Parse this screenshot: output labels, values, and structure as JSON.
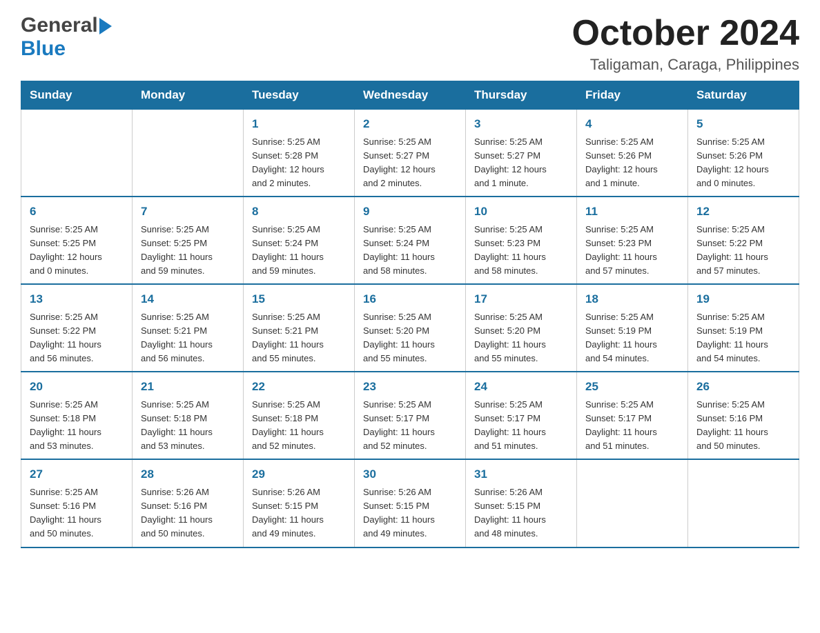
{
  "header": {
    "logo_general": "General",
    "logo_blue": "Blue",
    "month_title": "October 2024",
    "location": "Taligaman, Caraga, Philippines"
  },
  "weekdays": [
    "Sunday",
    "Monday",
    "Tuesday",
    "Wednesday",
    "Thursday",
    "Friday",
    "Saturday"
  ],
  "weeks": [
    [
      {
        "day": "",
        "info": ""
      },
      {
        "day": "",
        "info": ""
      },
      {
        "day": "1",
        "info": "Sunrise: 5:25 AM\nSunset: 5:28 PM\nDaylight: 12 hours\nand 2 minutes."
      },
      {
        "day": "2",
        "info": "Sunrise: 5:25 AM\nSunset: 5:27 PM\nDaylight: 12 hours\nand 2 minutes."
      },
      {
        "day": "3",
        "info": "Sunrise: 5:25 AM\nSunset: 5:27 PM\nDaylight: 12 hours\nand 1 minute."
      },
      {
        "day": "4",
        "info": "Sunrise: 5:25 AM\nSunset: 5:26 PM\nDaylight: 12 hours\nand 1 minute."
      },
      {
        "day": "5",
        "info": "Sunrise: 5:25 AM\nSunset: 5:26 PM\nDaylight: 12 hours\nand 0 minutes."
      }
    ],
    [
      {
        "day": "6",
        "info": "Sunrise: 5:25 AM\nSunset: 5:25 PM\nDaylight: 12 hours\nand 0 minutes."
      },
      {
        "day": "7",
        "info": "Sunrise: 5:25 AM\nSunset: 5:25 PM\nDaylight: 11 hours\nand 59 minutes."
      },
      {
        "day": "8",
        "info": "Sunrise: 5:25 AM\nSunset: 5:24 PM\nDaylight: 11 hours\nand 59 minutes."
      },
      {
        "day": "9",
        "info": "Sunrise: 5:25 AM\nSunset: 5:24 PM\nDaylight: 11 hours\nand 58 minutes."
      },
      {
        "day": "10",
        "info": "Sunrise: 5:25 AM\nSunset: 5:23 PM\nDaylight: 11 hours\nand 58 minutes."
      },
      {
        "day": "11",
        "info": "Sunrise: 5:25 AM\nSunset: 5:23 PM\nDaylight: 11 hours\nand 57 minutes."
      },
      {
        "day": "12",
        "info": "Sunrise: 5:25 AM\nSunset: 5:22 PM\nDaylight: 11 hours\nand 57 minutes."
      }
    ],
    [
      {
        "day": "13",
        "info": "Sunrise: 5:25 AM\nSunset: 5:22 PM\nDaylight: 11 hours\nand 56 minutes."
      },
      {
        "day": "14",
        "info": "Sunrise: 5:25 AM\nSunset: 5:21 PM\nDaylight: 11 hours\nand 56 minutes."
      },
      {
        "day": "15",
        "info": "Sunrise: 5:25 AM\nSunset: 5:21 PM\nDaylight: 11 hours\nand 55 minutes."
      },
      {
        "day": "16",
        "info": "Sunrise: 5:25 AM\nSunset: 5:20 PM\nDaylight: 11 hours\nand 55 minutes."
      },
      {
        "day": "17",
        "info": "Sunrise: 5:25 AM\nSunset: 5:20 PM\nDaylight: 11 hours\nand 55 minutes."
      },
      {
        "day": "18",
        "info": "Sunrise: 5:25 AM\nSunset: 5:19 PM\nDaylight: 11 hours\nand 54 minutes."
      },
      {
        "day": "19",
        "info": "Sunrise: 5:25 AM\nSunset: 5:19 PM\nDaylight: 11 hours\nand 54 minutes."
      }
    ],
    [
      {
        "day": "20",
        "info": "Sunrise: 5:25 AM\nSunset: 5:18 PM\nDaylight: 11 hours\nand 53 minutes."
      },
      {
        "day": "21",
        "info": "Sunrise: 5:25 AM\nSunset: 5:18 PM\nDaylight: 11 hours\nand 53 minutes."
      },
      {
        "day": "22",
        "info": "Sunrise: 5:25 AM\nSunset: 5:18 PM\nDaylight: 11 hours\nand 52 minutes."
      },
      {
        "day": "23",
        "info": "Sunrise: 5:25 AM\nSunset: 5:17 PM\nDaylight: 11 hours\nand 52 minutes."
      },
      {
        "day": "24",
        "info": "Sunrise: 5:25 AM\nSunset: 5:17 PM\nDaylight: 11 hours\nand 51 minutes."
      },
      {
        "day": "25",
        "info": "Sunrise: 5:25 AM\nSunset: 5:17 PM\nDaylight: 11 hours\nand 51 minutes."
      },
      {
        "day": "26",
        "info": "Sunrise: 5:25 AM\nSunset: 5:16 PM\nDaylight: 11 hours\nand 50 minutes."
      }
    ],
    [
      {
        "day": "27",
        "info": "Sunrise: 5:25 AM\nSunset: 5:16 PM\nDaylight: 11 hours\nand 50 minutes."
      },
      {
        "day": "28",
        "info": "Sunrise: 5:26 AM\nSunset: 5:16 PM\nDaylight: 11 hours\nand 50 minutes."
      },
      {
        "day": "29",
        "info": "Sunrise: 5:26 AM\nSunset: 5:15 PM\nDaylight: 11 hours\nand 49 minutes."
      },
      {
        "day": "30",
        "info": "Sunrise: 5:26 AM\nSunset: 5:15 PM\nDaylight: 11 hours\nand 49 minutes."
      },
      {
        "day": "31",
        "info": "Sunrise: 5:26 AM\nSunset: 5:15 PM\nDaylight: 11 hours\nand 48 minutes."
      },
      {
        "day": "",
        "info": ""
      },
      {
        "day": "",
        "info": ""
      }
    ]
  ]
}
